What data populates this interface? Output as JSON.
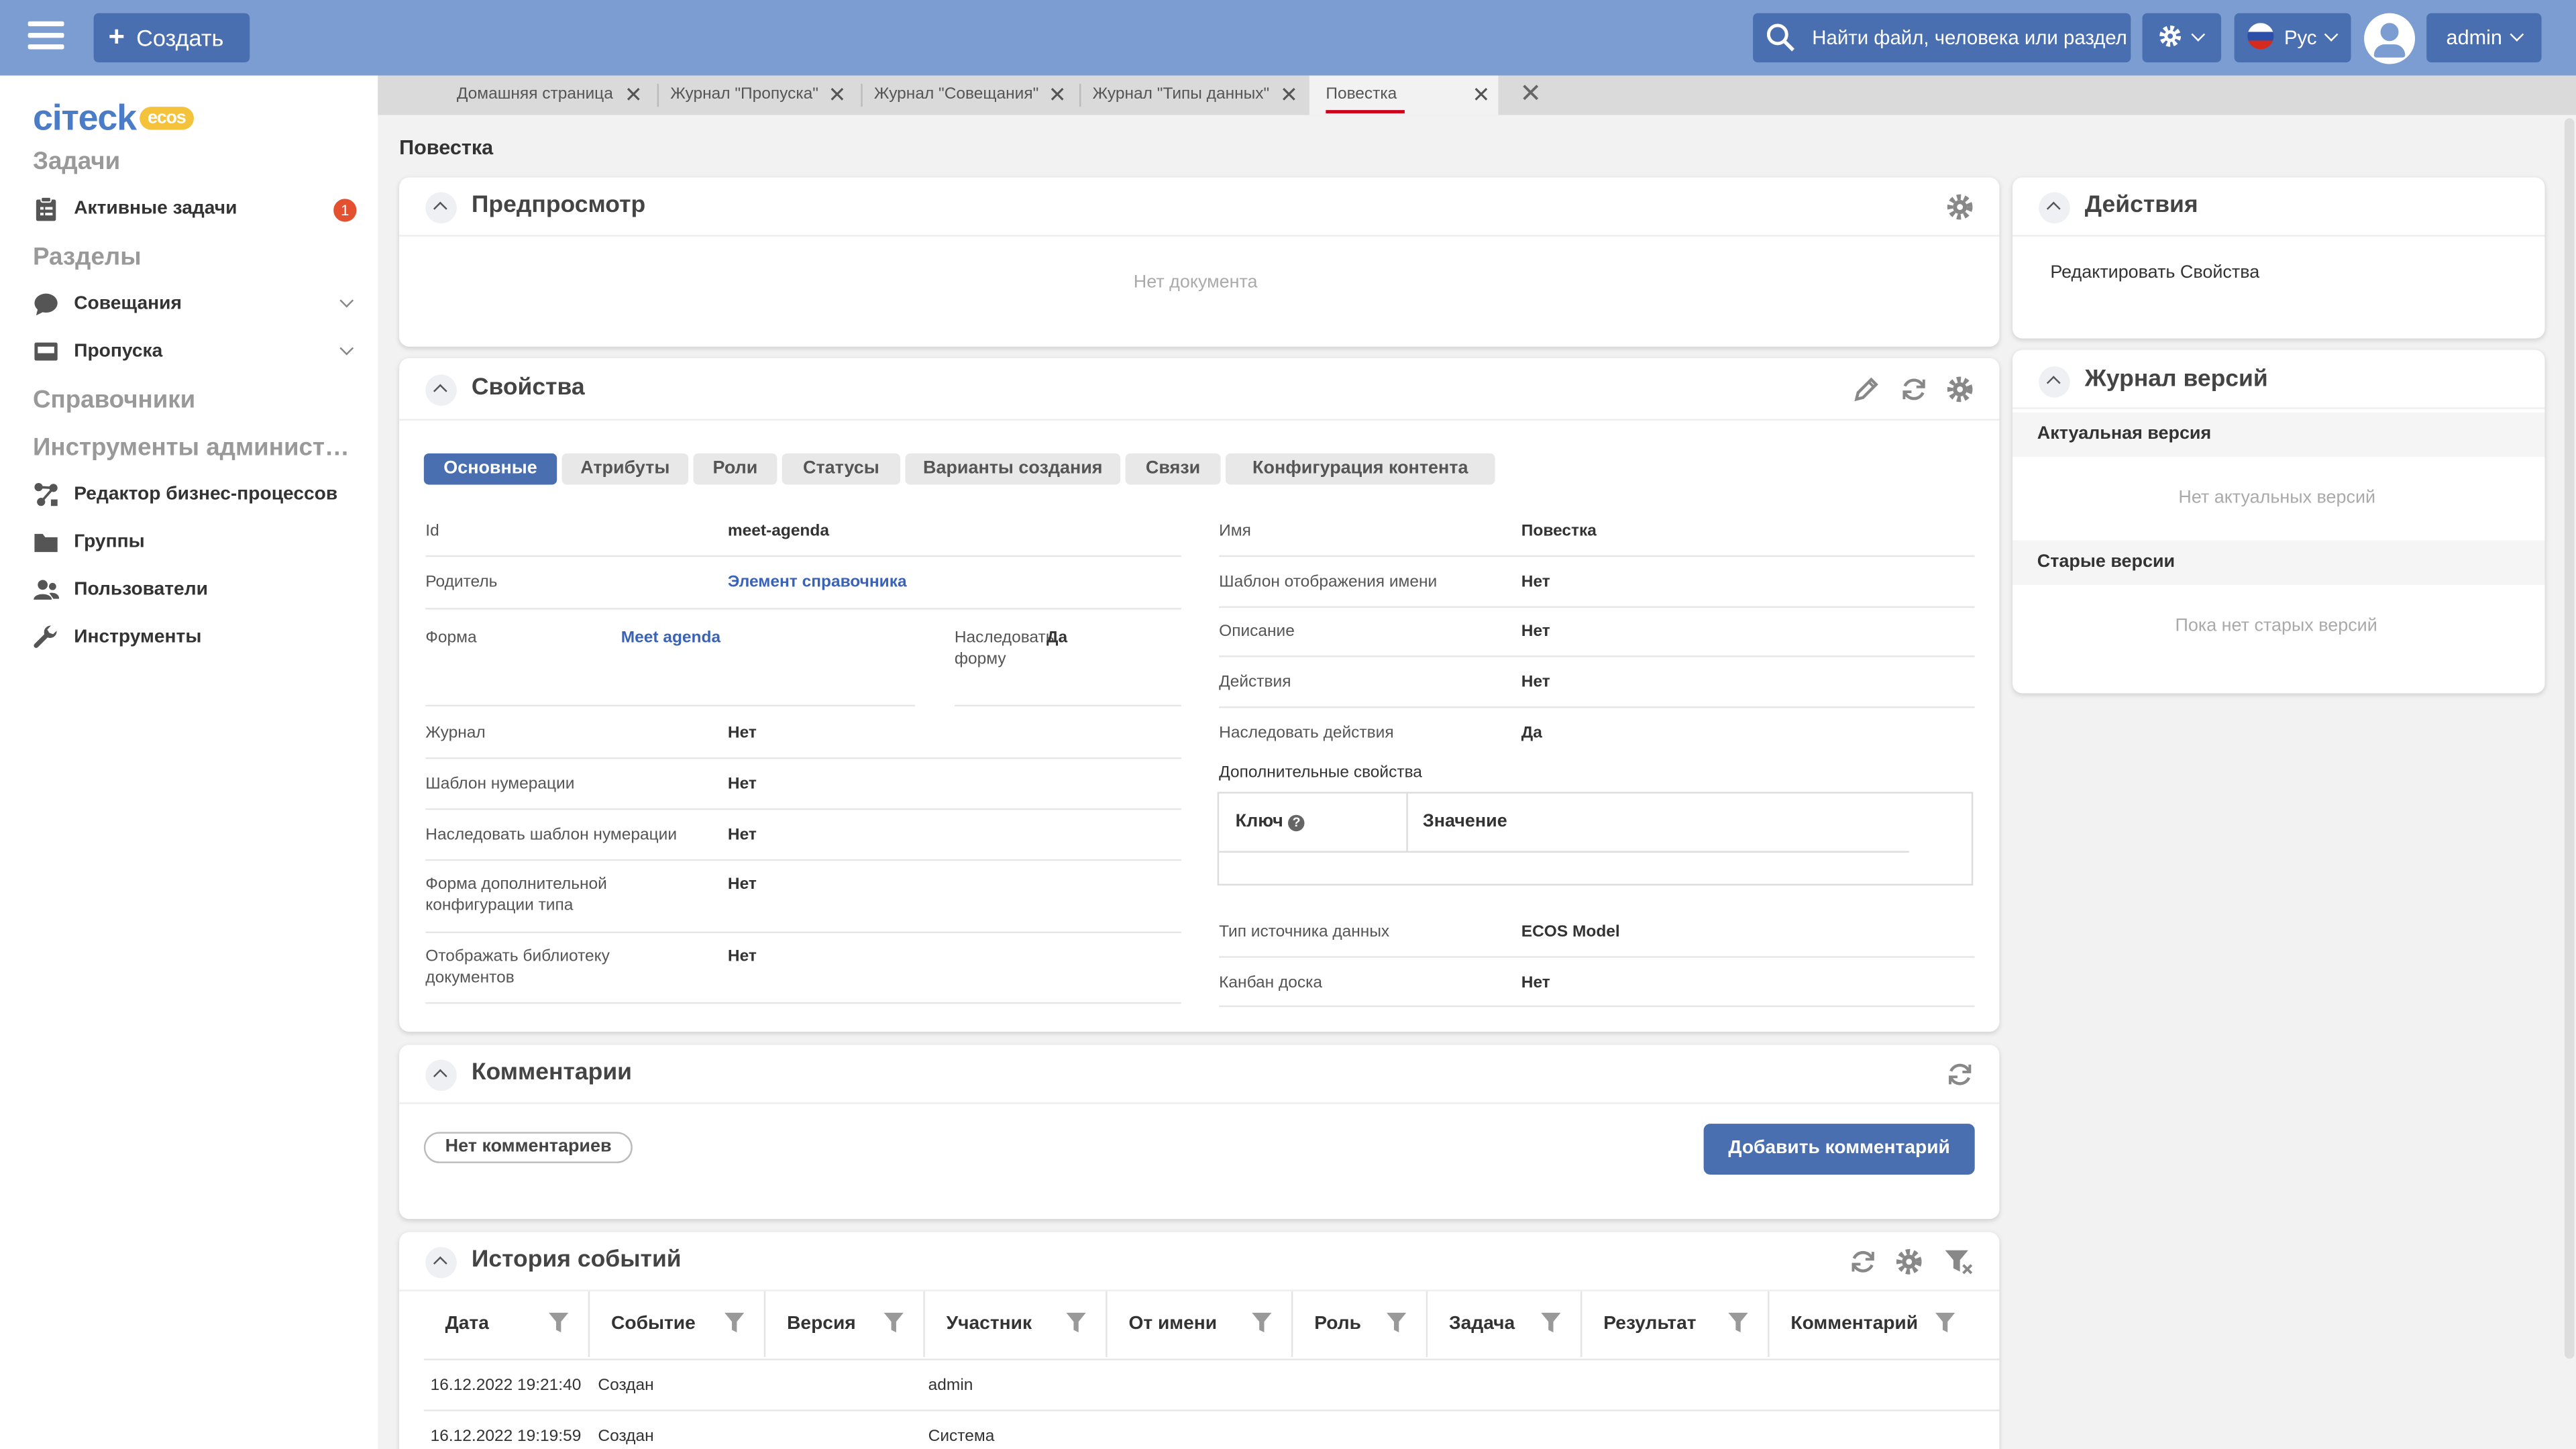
{
  "topbar": {
    "create_label": "Создать",
    "search_placeholder": "Найти файл, человека или раздел",
    "language": "Рус",
    "user": "admin",
    "colors": {
      "bar": "#7b9dd2",
      "button": "#4a6fb0"
    }
  },
  "sidebar": {
    "logo_text": "ciтeck",
    "logo_badge": "ecos",
    "sections": [
      {
        "title": "Задачи"
      },
      {
        "title": "Разделы"
      },
      {
        "title": "Справочники"
      },
      {
        "title": "Инструменты администрирования"
      }
    ],
    "items": [
      {
        "label": "Активные задачи",
        "icon": "clipboard-icon",
        "badge": "1"
      },
      {
        "label": "Совещания",
        "icon": "chat-bubble-icon"
      },
      {
        "label": "Пропуска",
        "icon": "id-card-icon"
      },
      {
        "label": "Редактор бизнес-процессов",
        "icon": "process-icon"
      },
      {
        "label": "Группы",
        "icon": "folder-icon"
      },
      {
        "label": "Пользователи",
        "icon": "users-icon"
      },
      {
        "label": "Инструменты",
        "icon": "wrench-icon"
      }
    ]
  },
  "tabs": [
    {
      "label": "Домашняя страница"
    },
    {
      "label": "Журнал \"Пропуска\""
    },
    {
      "label": "Журнал \"Совещания\""
    },
    {
      "label": "Журнал \"Типы данных\""
    },
    {
      "label": "Повестка",
      "active": true
    }
  ],
  "page": {
    "title": "Повестка"
  },
  "preview": {
    "title": "Предпросмотр",
    "empty": "Нет документа"
  },
  "properties": {
    "title": "Свойства",
    "subtabs": [
      "Основные",
      "Атрибуты",
      "Роли",
      "Статусы",
      "Варианты создания",
      "Связи",
      "Конфигурация контента"
    ],
    "left": [
      {
        "label": "Id",
        "value": "meet-agenda"
      },
      {
        "label": "Родитель",
        "value": "Элемент справочника"
      },
      {
        "label": "Форма",
        "value": "Meet agenda"
      },
      {
        "label": "Журнал",
        "value": "Нет"
      },
      {
        "label": "Шаблон нумерации",
        "value": "Нет"
      },
      {
        "label": "Наследовать шаблон нумерации",
        "value": "Нет"
      },
      {
        "label": "Форма дополнительной конфигурации типа",
        "value": "Нет"
      },
      {
        "label": "Отображать библиотеку документов",
        "value": "Нет"
      }
    ],
    "inherit_form": {
      "label": "Наследовать форму",
      "value": "Да"
    },
    "right": [
      {
        "label": "Имя",
        "value": "Повестка"
      },
      {
        "label": "Шаблон отображения имени",
        "value": "Нет"
      },
      {
        "label": "Описание",
        "value": "Нет"
      },
      {
        "label": "Действия",
        "value": "Нет"
      },
      {
        "label": "Наследовать действия",
        "value": "Да"
      }
    ],
    "additional": {
      "title": "Дополнительные свойства",
      "key_header": "Ключ",
      "value_header": "Значение"
    },
    "right_bottom": [
      {
        "label": "Тип источника данных",
        "value": "ECOS Model"
      },
      {
        "label": "Канбан доска",
        "value": "Нет"
      }
    ]
  },
  "comments": {
    "title": "Комментарии",
    "empty": "Нет комментариев",
    "add_label": "Добавить комментарий"
  },
  "history": {
    "title": "История событий",
    "columns": [
      "Дата",
      "Событие",
      "Версия",
      "Участник",
      "От имени",
      "Роль",
      "Задача",
      "Результат",
      "Комментарий"
    ],
    "rows": [
      {
        "date": "16.12.2022 19:21:40",
        "event": "Создан",
        "participant": "admin"
      },
      {
        "date": "16.12.2022 19:19:59",
        "event": "Создан",
        "participant": "Система"
      }
    ]
  },
  "actions": {
    "title": "Действия",
    "edit_label": "Редактировать Свойства"
  },
  "versions": {
    "title": "Журнал версий",
    "current_title": "Актуальная версия",
    "current_empty": "Нет актуальных версий",
    "old_title": "Старые версии",
    "old_empty": "Пока нет старых версий"
  }
}
